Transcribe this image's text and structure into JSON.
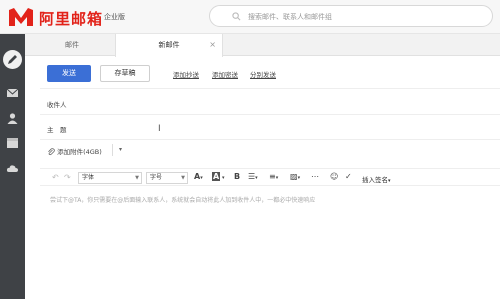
{
  "header": {
    "logo_text": "阿里邮箱",
    "edition": "企业版",
    "search_placeholder": "搜索邮件、联系人和邮件组"
  },
  "tabs": [
    {
      "label": "邮件"
    },
    {
      "label": "新邮件",
      "close": "×"
    }
  ],
  "toolbar": {
    "send_label": "发送",
    "draft_label": "存草稿",
    "add_cc": "添加抄送",
    "add_bcc": "添加密送",
    "separate_send": "分别发送"
  },
  "form": {
    "to_label": "收件人",
    "subject_label": "主　题",
    "attach_label": "添加附件(4GB)",
    "attach_caret": "▾"
  },
  "editor": {
    "font_label": "字体",
    "size_label": "字号",
    "insert_signature": "插入签名",
    "hint": "尝试下@TA，你只需要在@后面输入联系人，系统就会自动将此人加到收件人中，一都必中快速响应"
  },
  "icons": [
    "logo-m-icon",
    "search-icon",
    "compose-icon",
    "mail-icon",
    "contacts-icon",
    "calendar-icon",
    "cloud-icon",
    "paperclip-icon",
    "undo-icon",
    "redo-icon",
    "font-color-icon",
    "bg-color-icon",
    "bold-icon",
    "list-icon",
    "ordered-list-icon",
    "image-icon",
    "more-icon",
    "emoji-icon",
    "spellcheck-icon"
  ],
  "colors": {
    "brand_red": "#e2231a",
    "send_blue": "#3b6fd6",
    "rail": "#3f4246"
  }
}
